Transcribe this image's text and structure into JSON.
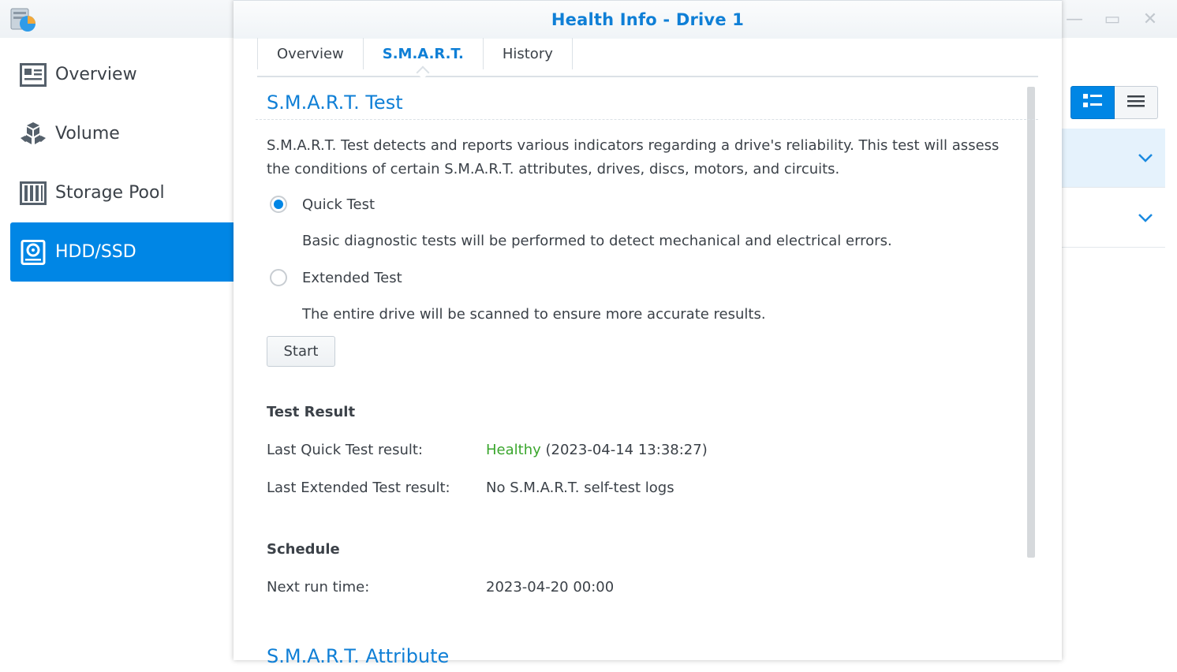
{
  "app": {
    "sidebar": [
      {
        "label": "Overview",
        "icon": "overview-icon"
      },
      {
        "label": "Volume",
        "icon": "volume-icon"
      },
      {
        "label": "Storage Pool",
        "icon": "storage-pool-icon"
      },
      {
        "label": "HDD/SSD",
        "icon": "hdd-icon"
      }
    ],
    "accent": "#0086e5"
  },
  "modal": {
    "title": "Health Info - Drive 1",
    "tabs": [
      "Overview",
      "S.M.A.R.T.",
      "History"
    ],
    "active_tab": "S.M.A.R.T.",
    "smart_test": {
      "title": "S.M.A.R.T. Test",
      "description": "S.M.A.R.T. Test detects and reports various indicators regarding a drive's reliability. This test will assess the conditions of certain S.M.A.R.T. attributes, drives, discs, motors, and circuits.",
      "options": [
        {
          "label": "Quick Test",
          "description": "Basic diagnostic tests will be performed to detect mechanical and electrical errors.",
          "selected": true
        },
        {
          "label": "Extended Test",
          "description": "The entire drive will be scanned to ensure more accurate results.",
          "selected": false
        }
      ],
      "start_label": "Start"
    },
    "test_result": {
      "title": "Test Result",
      "quick_label": "Last Quick Test result:",
      "quick_status": "Healthy",
      "quick_time": "(2023-04-14 13:38:27)",
      "extended_label": "Last Extended Test result:",
      "extended_value": "No S.M.A.R.T. self-test logs"
    },
    "schedule": {
      "title": "Schedule",
      "next_label": "Next run time:",
      "next_value": "2023-04-20 00:00"
    },
    "attribute_title": "S.M.A.R.T. Attribute"
  }
}
